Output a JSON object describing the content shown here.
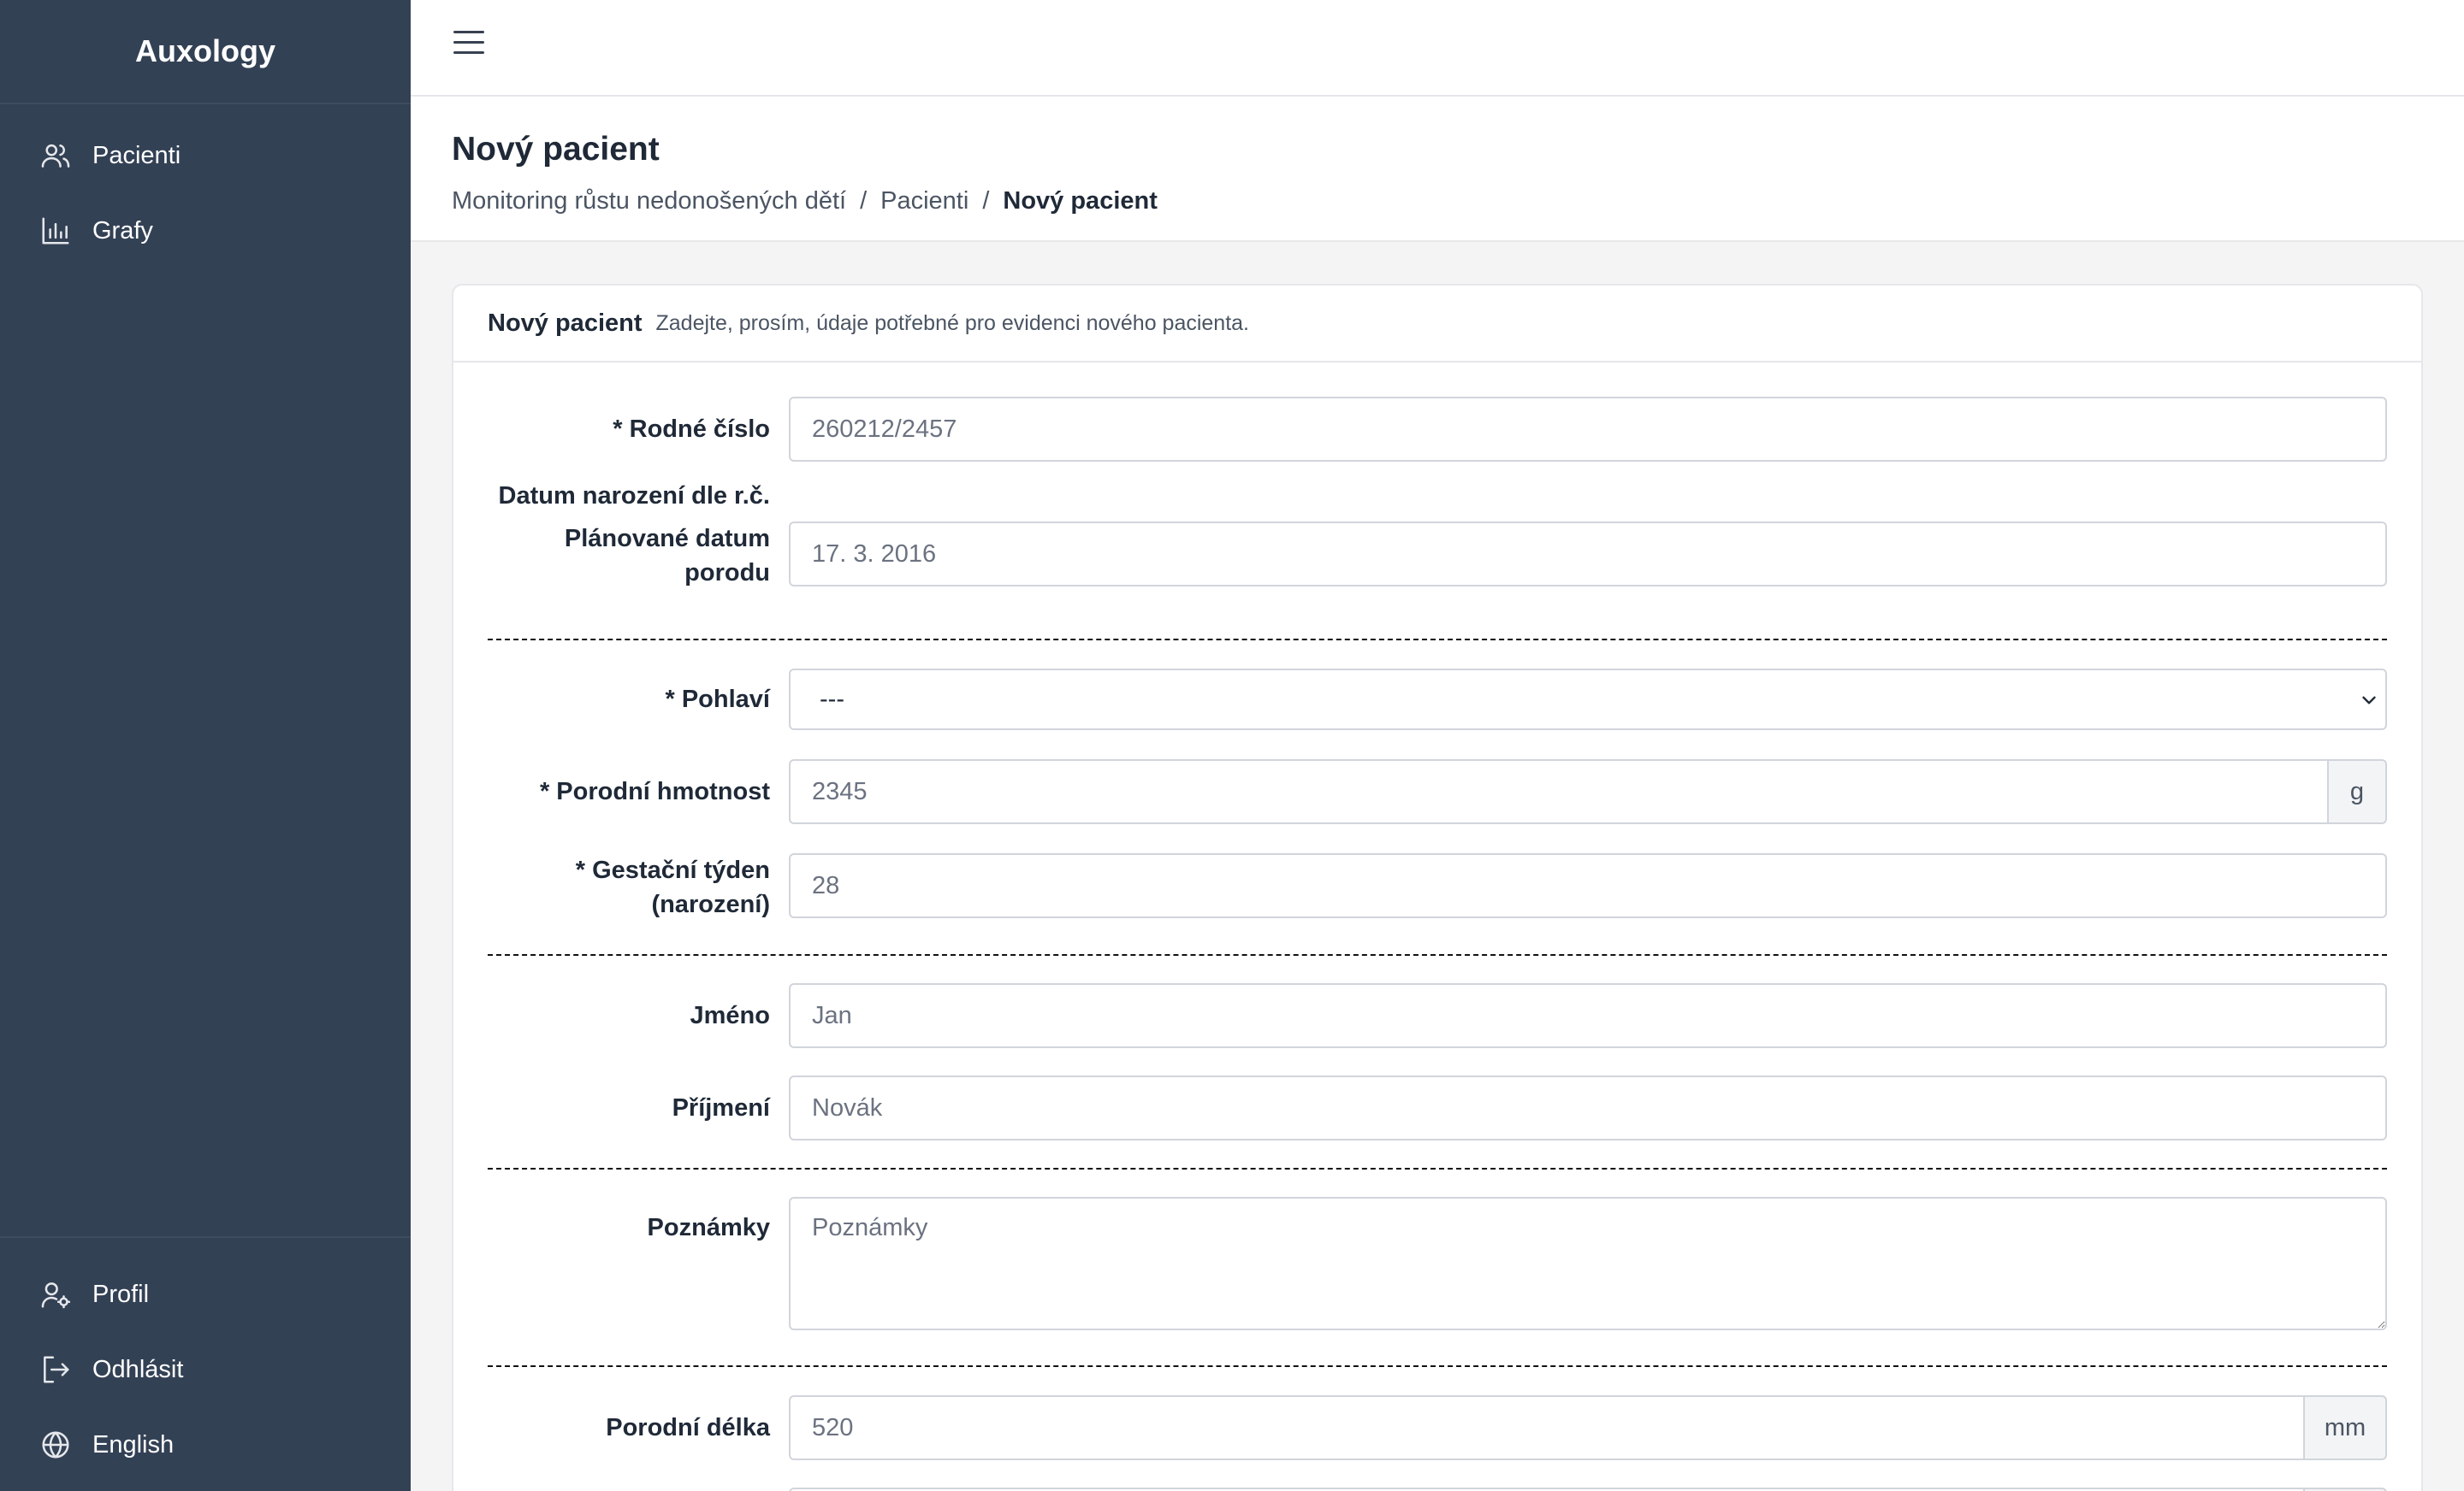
{
  "app": {
    "title": "Auxology"
  },
  "sidebar": {
    "items": [
      {
        "label": "Pacienti",
        "icon": "users-icon"
      },
      {
        "label": "Grafy",
        "icon": "bar-chart-icon"
      }
    ],
    "bottom_items": [
      {
        "label": "Profil",
        "icon": "user-settings-icon"
      },
      {
        "label": "Odhlásit",
        "icon": "logout-icon"
      },
      {
        "label": "English",
        "icon": "globe-icon"
      }
    ]
  },
  "header": {
    "title": "Nový pacient",
    "breadcrumb": [
      {
        "label": "Monitoring růstu nedonošených dětí"
      },
      {
        "label": "Pacienti"
      },
      {
        "label": "Nový pacient"
      }
    ],
    "breadcrumb_separator": "/"
  },
  "card": {
    "title": "Nový pacient",
    "subtitle": "Zadejte, prosím, údaje potřebné pro evidenci nového pacienta."
  },
  "form": {
    "rodne_cislo": {
      "label": "* Rodné číslo",
      "placeholder": "260212/2457",
      "value": ""
    },
    "datum_narozeni": {
      "label": "Datum narození dle r.č."
    },
    "planovane_datum": {
      "label_line1": "Plánované datum",
      "label_line2": "porodu",
      "placeholder": "17. 3. 2016",
      "value": ""
    },
    "pohlavi": {
      "label": "* Pohlaví",
      "selected": "---"
    },
    "porodni_hmotnost": {
      "label": "* Porodní hmotnost",
      "placeholder": "2345",
      "value": "",
      "unit": "g"
    },
    "gestacni_tyden": {
      "label_line1": "* Gestační týden",
      "label_line2": "(narození)",
      "placeholder": "28",
      "value": ""
    },
    "jmeno": {
      "label": "Jméno",
      "placeholder": "Jan",
      "value": ""
    },
    "prijmeni": {
      "label": "Příjmení",
      "placeholder": "Novák",
      "value": ""
    },
    "poznamky": {
      "label": "Poznámky",
      "placeholder": "Poznámky",
      "value": ""
    },
    "porodni_delka": {
      "label": "Porodní délka",
      "placeholder": "520",
      "value": "",
      "unit": "mm"
    }
  },
  "colors": {
    "sidebar_bg": "#334155",
    "page_bg": "#f4f4f4",
    "card_bg": "#ffffff"
  }
}
